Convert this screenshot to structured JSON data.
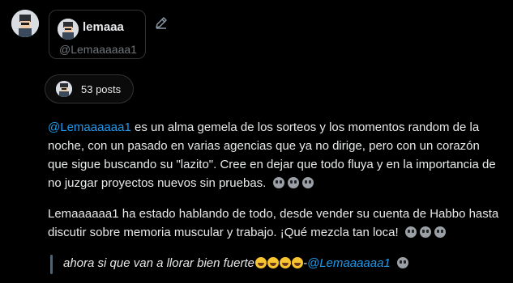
{
  "profile": {
    "display_name": "lemaaa",
    "handle": "@Lemaaaaaa1"
  },
  "posts_pill": {
    "label": "53 posts"
  },
  "summary": {
    "p1_mention": "@Lemaaaaaa1",
    "p1_text": " es un alma gemela de los sorteos y los momentos random de la noche, con un pasado en varias agencias que ya no dirige, pero con un corazón que sigue buscando su \"lazito\". Cree en dejar que todo fluya y en la importancia de no juzgar proyectos nuevos sin pruebas.",
    "p1_emoji": [
      "skull-emoji",
      "skull-emoji",
      "skull-emoji"
    ],
    "p2_text": "Lemaaaaaa1 ha estado hablando de todo, desde vender su cuenta de Habbo hasta discutir sobre memoria muscular y trabajo. ¡Qué mezcla tan loca!",
    "p2_emoji": [
      "skull-emoji",
      "skull-emoji",
      "skull-emoji"
    ]
  },
  "quote": {
    "text": "ahora si que van a llorar bien fuerte",
    "emoji": [
      "sweat-smile-emoji",
      "rofl-emoji",
      "rofl-emoji",
      "rofl-emoji"
    ],
    "dash": "-",
    "mention": "@Lemaaaaaa1",
    "trailing_emoji": "skull-emoji"
  },
  "colors": {
    "background": "#000000",
    "text": "#e7e9ea",
    "muted": "#71767b",
    "link": "#1d9bf0",
    "border": "#2f3336"
  }
}
